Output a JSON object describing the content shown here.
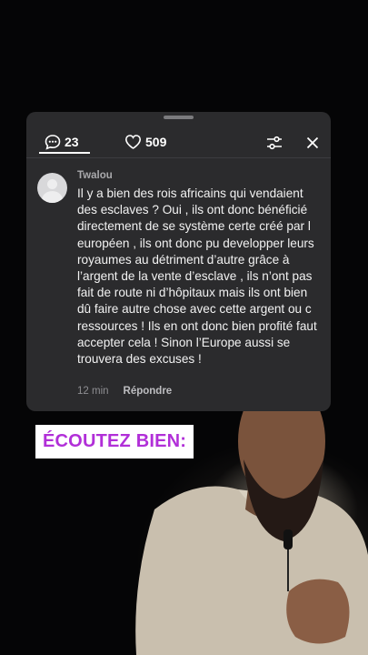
{
  "comments_panel": {
    "comment_count": "23",
    "like_count": "509"
  },
  "comment": {
    "username": "Twalou",
    "text": "Il y a bien des rois africains qui vendaient des esclaves ? Oui , ils ont donc bénéficié directement de se système certe créé par l européen , ils ont donc pu developper leurs royaumes au détriment d’autre grâce à l’argent de la vente d’esclave , ils n’ont pas fait de route ni d’hôpitaux mais ils ont bien dû faire autre chose avec cette argent ou c ressources ! Ils en ont donc bien profité faut accepter cela ! Sinon l’Europe aussi se trouvera des excuses !",
    "time": "12 min",
    "reply_label": "Répondre"
  },
  "overlay": {
    "caption": "ÉCOUTEZ BIEN:"
  },
  "colors": {
    "panel_bg": "#2b2b2d",
    "caption_text": "#b12fd8",
    "caption_bg": "#ffffff"
  },
  "icons": [
    "comment-bubble-icon",
    "heart-icon",
    "filter-icon",
    "close-icon"
  ]
}
